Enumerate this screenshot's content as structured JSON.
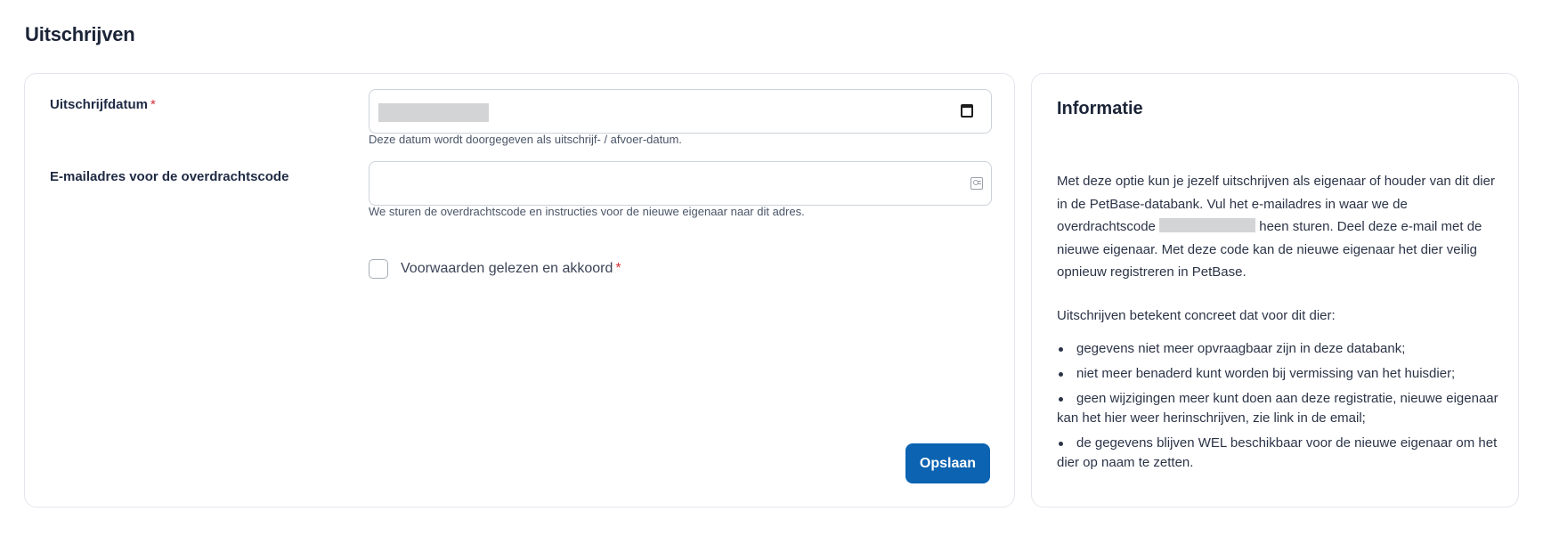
{
  "page": {
    "title": "Uitschrijven"
  },
  "form": {
    "date": {
      "label": "Uitschrijfdatum",
      "required_mark": "*",
      "hint": "Deze datum wordt doorgegeven als uitschrijf- / afvoer-datum."
    },
    "email": {
      "label": "E-mailadres voor de overdrachtscode",
      "value": "",
      "hint": "We sturen de overdrachtscode en instructies voor de nieuwe eigenaar naar dit adres."
    },
    "terms": {
      "label": "Voorwaarden gelezen en akkoord",
      "required_mark": "*",
      "checked": false
    },
    "save_label": "Opslaan"
  },
  "info": {
    "title": "Informatie",
    "paragraph_start": "Met deze optie kun je jezelf uitschrijven als eigenaar of houder van dit dier in de PetBase-databank. Vul het e-mailadres in waar we de overdrachtscode",
    "paragraph_end": "heen sturen. Deel deze e-mail met de nieuwe eigenaar. Met deze code kan de nieuwe eigenaar het dier veilig opnieuw registreren in PetBase.",
    "list_intro": "Uitschrijven betekent concreet dat voor dit dier:",
    "items": [
      "gegevens niet meer opvraagbaar zijn in deze databank;",
      "niet meer benaderd kunt worden bij vermissing van het huisdier;",
      "geen wijzigingen meer kunt doen aan deze registratie, nieuwe eigenaar kan het hier weer herinschrijven, zie link in de email;",
      "de gegevens blijven WEL beschikbaar voor de nieuwe eigenaar om het dier op naam te zetten."
    ]
  },
  "colors": {
    "primary_button": "#0b63b1",
    "required": "#d6303a",
    "card_border": "#e3e6ec"
  }
}
